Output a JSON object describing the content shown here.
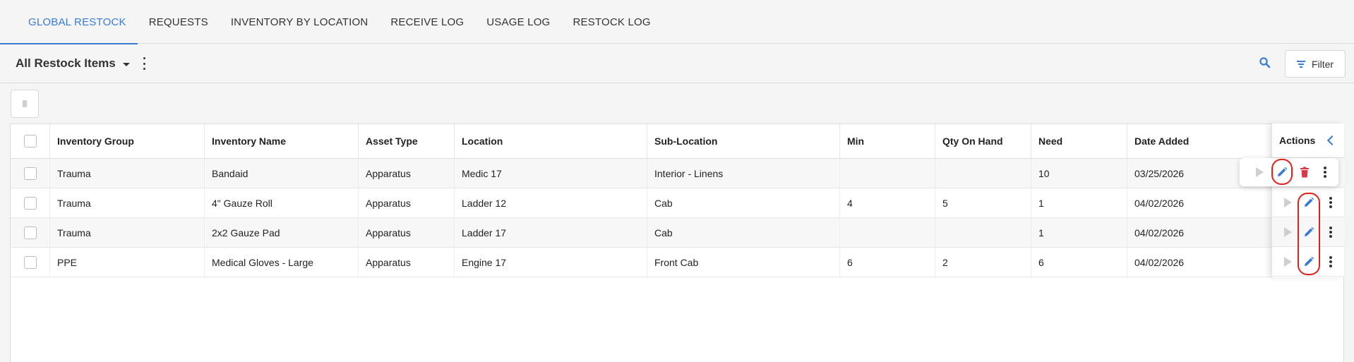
{
  "tabs": [
    "GLOBAL RESTOCK",
    "REQUESTS",
    "INVENTORY BY LOCATION",
    "RECEIVE LOG",
    "USAGE LOG",
    "RESTOCK LOG"
  ],
  "active_tab": "GLOBAL RESTOCK",
  "toolbar": {
    "view_title": "All Restock Items",
    "filter_label": "Filter"
  },
  "table": {
    "columns": [
      "Inventory Group",
      "Inventory Name",
      "Asset Type",
      "Location",
      "Sub-Location",
      "Min",
      "Qty On Hand",
      "Need",
      "Date Added"
    ],
    "actions_label": "Actions",
    "rows": [
      [
        "Trauma",
        "Bandaid",
        "Apparatus",
        "Medic 17",
        "Interior - Linens",
        "",
        "",
        "10",
        "03/25/2026"
      ],
      [
        "Trauma",
        "4\" Gauze Roll",
        "Apparatus",
        "Ladder 12",
        "Cab",
        "4",
        "5",
        "1",
        "04/02/2026"
      ],
      [
        "Trauma",
        "2x2 Gauze Pad",
        "Apparatus",
        "Ladder 17",
        "Cab",
        "",
        "",
        "1",
        "04/02/2026"
      ],
      [
        "PPE",
        "Medical Gloves - Large",
        "Apparatus",
        "Engine 17",
        "Front Cab",
        "6",
        "2",
        "6",
        "04/02/2026"
      ]
    ]
  },
  "colors": {
    "accent": "#3a7bd5",
    "danger": "#d9374b",
    "annotation": "#e0201a"
  },
  "icons": {
    "search": "search-icon",
    "filter": "filter-icon",
    "edit": "edit-icon",
    "delete": "trash-icon",
    "play": "play-icon",
    "more": "kebab-icon"
  }
}
